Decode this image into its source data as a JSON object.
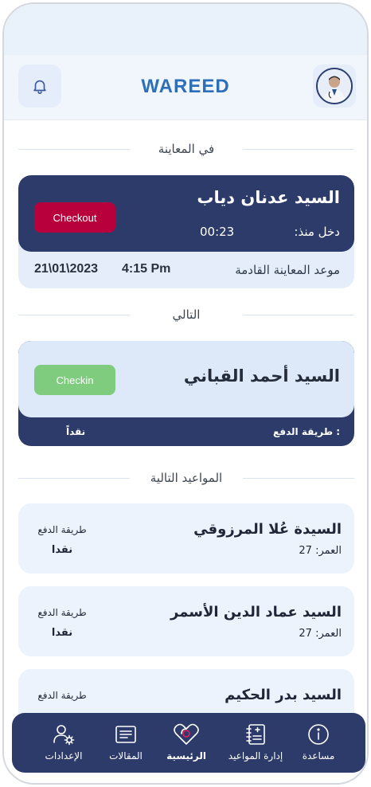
{
  "app": {
    "logo": "WAREED"
  },
  "sections": {
    "in_exam": "في المعاينة",
    "next": "التالي",
    "upcoming": "المواعيد التالية"
  },
  "current": {
    "name": "السيد عدنان دياب",
    "since_label": "دخل منذ:",
    "since_value": "00:23",
    "checkout_label": "Checkout",
    "next_exam_label": "موعد المعاينة القادمة",
    "next_exam_time": "4:15 Pm",
    "next_exam_date": "21\\01\\2023"
  },
  "next_patient": {
    "name": "السيد أحمد القباني",
    "checkin_label": "Checkin",
    "payment_label": ": طريقة الدفع",
    "payment_value": "نقداً"
  },
  "appointments": [
    {
      "name": "السيدة عُلا المرزوقي",
      "age": "العمر: 27",
      "payment_label": "طريقة الدفع",
      "payment_value": "نقدا"
    },
    {
      "name": "السيد عماد الدين الأسمر",
      "age": "العمر: 27",
      "payment_label": "طريقة الدفع",
      "payment_value": "نقدا"
    },
    {
      "name": "السيد بدر الحكيم",
      "payment_label": "طريقة الدفع"
    }
  ],
  "nav": {
    "settings": "الإعدادات",
    "articles": "المقالات",
    "home": "الرئيسية",
    "appointments": "إدارة المواعيد",
    "help": "مساعدة"
  },
  "colors": {
    "navy": "#2c3b69",
    "checkout": "#b8003c",
    "checkin": "#80cc7e",
    "brand": "#2d6fb8",
    "active_indicator": "#c2185b"
  }
}
